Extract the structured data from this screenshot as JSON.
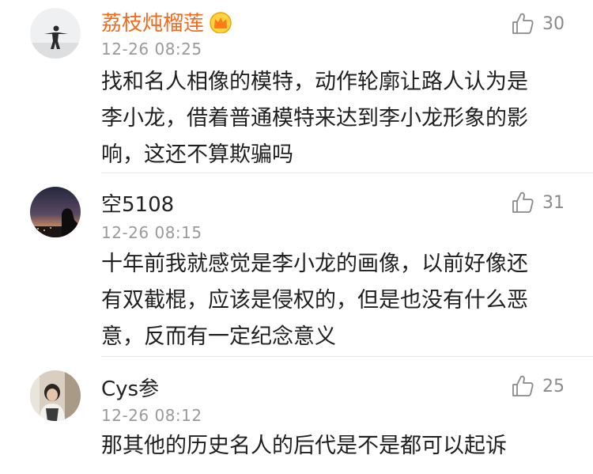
{
  "comments": [
    {
      "username": "荔枝炖榴莲",
      "vip": true,
      "time": "12-26 08:25",
      "likes": "30",
      "lines": [
        "找和名人相像的模特，动作轮廓让路人认为是",
        "李小龙，借着普通模特来达到李小龙形象的影",
        "响，这还不算欺骗吗"
      ]
    },
    {
      "username": "空5108",
      "vip": false,
      "time": "12-26 08:15",
      "likes": "31",
      "lines": [
        "十年前我就感觉是李小龙的画像，以前好像还",
        "有双截棍，应该是侵权的，但是也没有什么恶",
        "意，反而有一定纪念意义"
      ]
    },
    {
      "username": "Cys参",
      "vip": false,
      "time": "12-26 08:12",
      "likes": "25",
      "lines": [
        "那其他的历史名人的后代是不是都可以起诉"
      ]
    }
  ],
  "colors": {
    "vip_name": "#f36a1d",
    "meta_gray": "#9a9a9a",
    "divider": "#e6e6e6"
  },
  "icons": {
    "like": "thumbs-up-icon",
    "vip_badge": "crown-icon"
  }
}
